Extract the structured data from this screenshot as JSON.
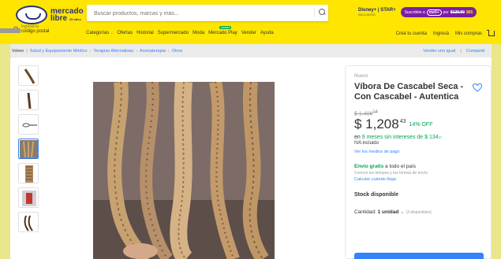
{
  "header": {
    "logo": {
      "line1": "mercado",
      "line2": "libre",
      "tag": "25 años"
    },
    "search": {
      "placeholder": "Buscar productos, marcas y más..."
    },
    "promo": {
      "brand": "Disney+ | STAR+",
      "brand_sub": "INCLUIDOS",
      "subscribe": "Suscribite a",
      "badge": "meli+",
      "por": "por",
      "old_price": "$129.90",
      "new_price": "$65"
    },
    "location": {
      "line1": "Ingresá tu",
      "line2": "código postal"
    },
    "nav": {
      "categories": "Categorías",
      "offers": "Ofertas",
      "history": "Historial",
      "supermarket": "Supermercado",
      "fashion": "Moda",
      "play": "Mercado Play",
      "play_badge": "GRATIS",
      "sell": "Vender",
      "help": "Ayuda"
    },
    "user_nav": {
      "create": "Creá tu cuenta",
      "login": "Ingresá",
      "purchases": "Mis compras"
    }
  },
  "breadcrumb": {
    "back": "Volver",
    "items": [
      "Salud y Equipamiento Médico",
      "Terapias Alternativas",
      "Aromaterapia",
      "Otros"
    ],
    "sell_same": "Vender uno igual",
    "share": "Compartir"
  },
  "product": {
    "condition": "Nuevo",
    "title": "Víbora De Cascabel Seca - Con Cascabel - Autentica",
    "old_price": "$ 1.406",
    "old_cents": "14",
    "price": "$ 1,208",
    "price_cents": "43",
    "discount": "14% OFF",
    "installments_prefix": "en",
    "installments_green": "9 meses sin intereses de $ 134",
    "installments_cents": "27",
    "iva": "IVA incluido",
    "payment_link": "Ver los medios de pago",
    "shipping_green": "Envío gratis",
    "shipping_rest": "a todo el país",
    "shipping_sub": "Conocé los tiempos y las formas de envío.",
    "shipping_link": "Calcular cuándo llega",
    "stock": "Stock disponible",
    "qty_label": "Cantidad:",
    "qty_value": "1 unidad",
    "qty_available": "(3 disponibles)"
  },
  "colors": {
    "header_bg": "#ffe600",
    "link": "#3483fa",
    "green": "#00a650",
    "meli_plus": "#7b1fa2"
  }
}
